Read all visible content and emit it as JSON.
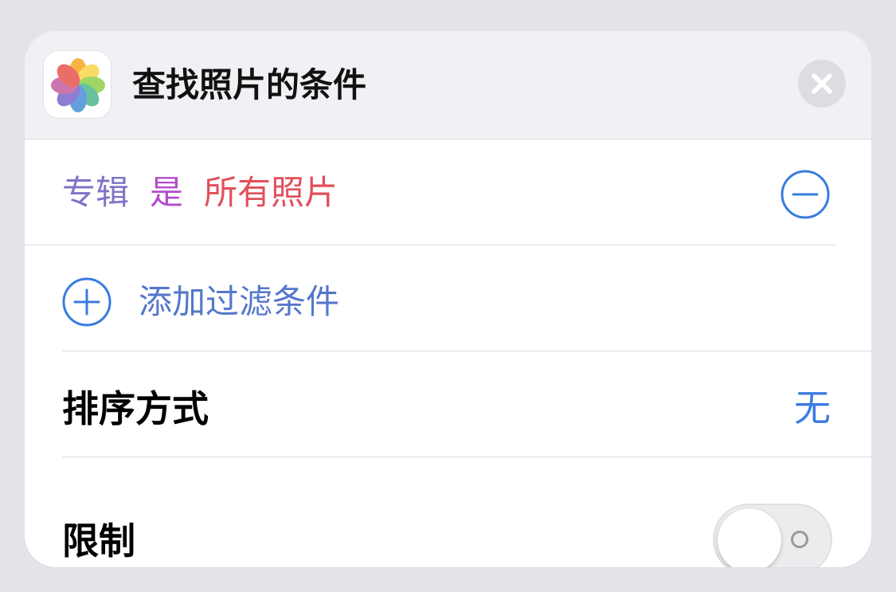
{
  "header": {
    "app_icon": "photos-app-icon",
    "title": "查找照片的条件",
    "close_icon": "close-icon"
  },
  "filter": {
    "key": "专辑",
    "operator": "是",
    "value": "所有照片",
    "remove_icon": "minus-circle-icon",
    "colors": {
      "key": "#7d74c7",
      "operator": "#b24dc9",
      "value": "#e2505a"
    }
  },
  "add_filter": {
    "label": "添加过滤条件",
    "icon": "plus-circle-icon"
  },
  "sort": {
    "label": "排序方式",
    "value": "无"
  },
  "limit": {
    "label": "限制",
    "toggle_on": false
  },
  "colors": {
    "accent": "#3a7be0",
    "background": "#e3e4e8",
    "header_background": "#f0f1f4"
  }
}
